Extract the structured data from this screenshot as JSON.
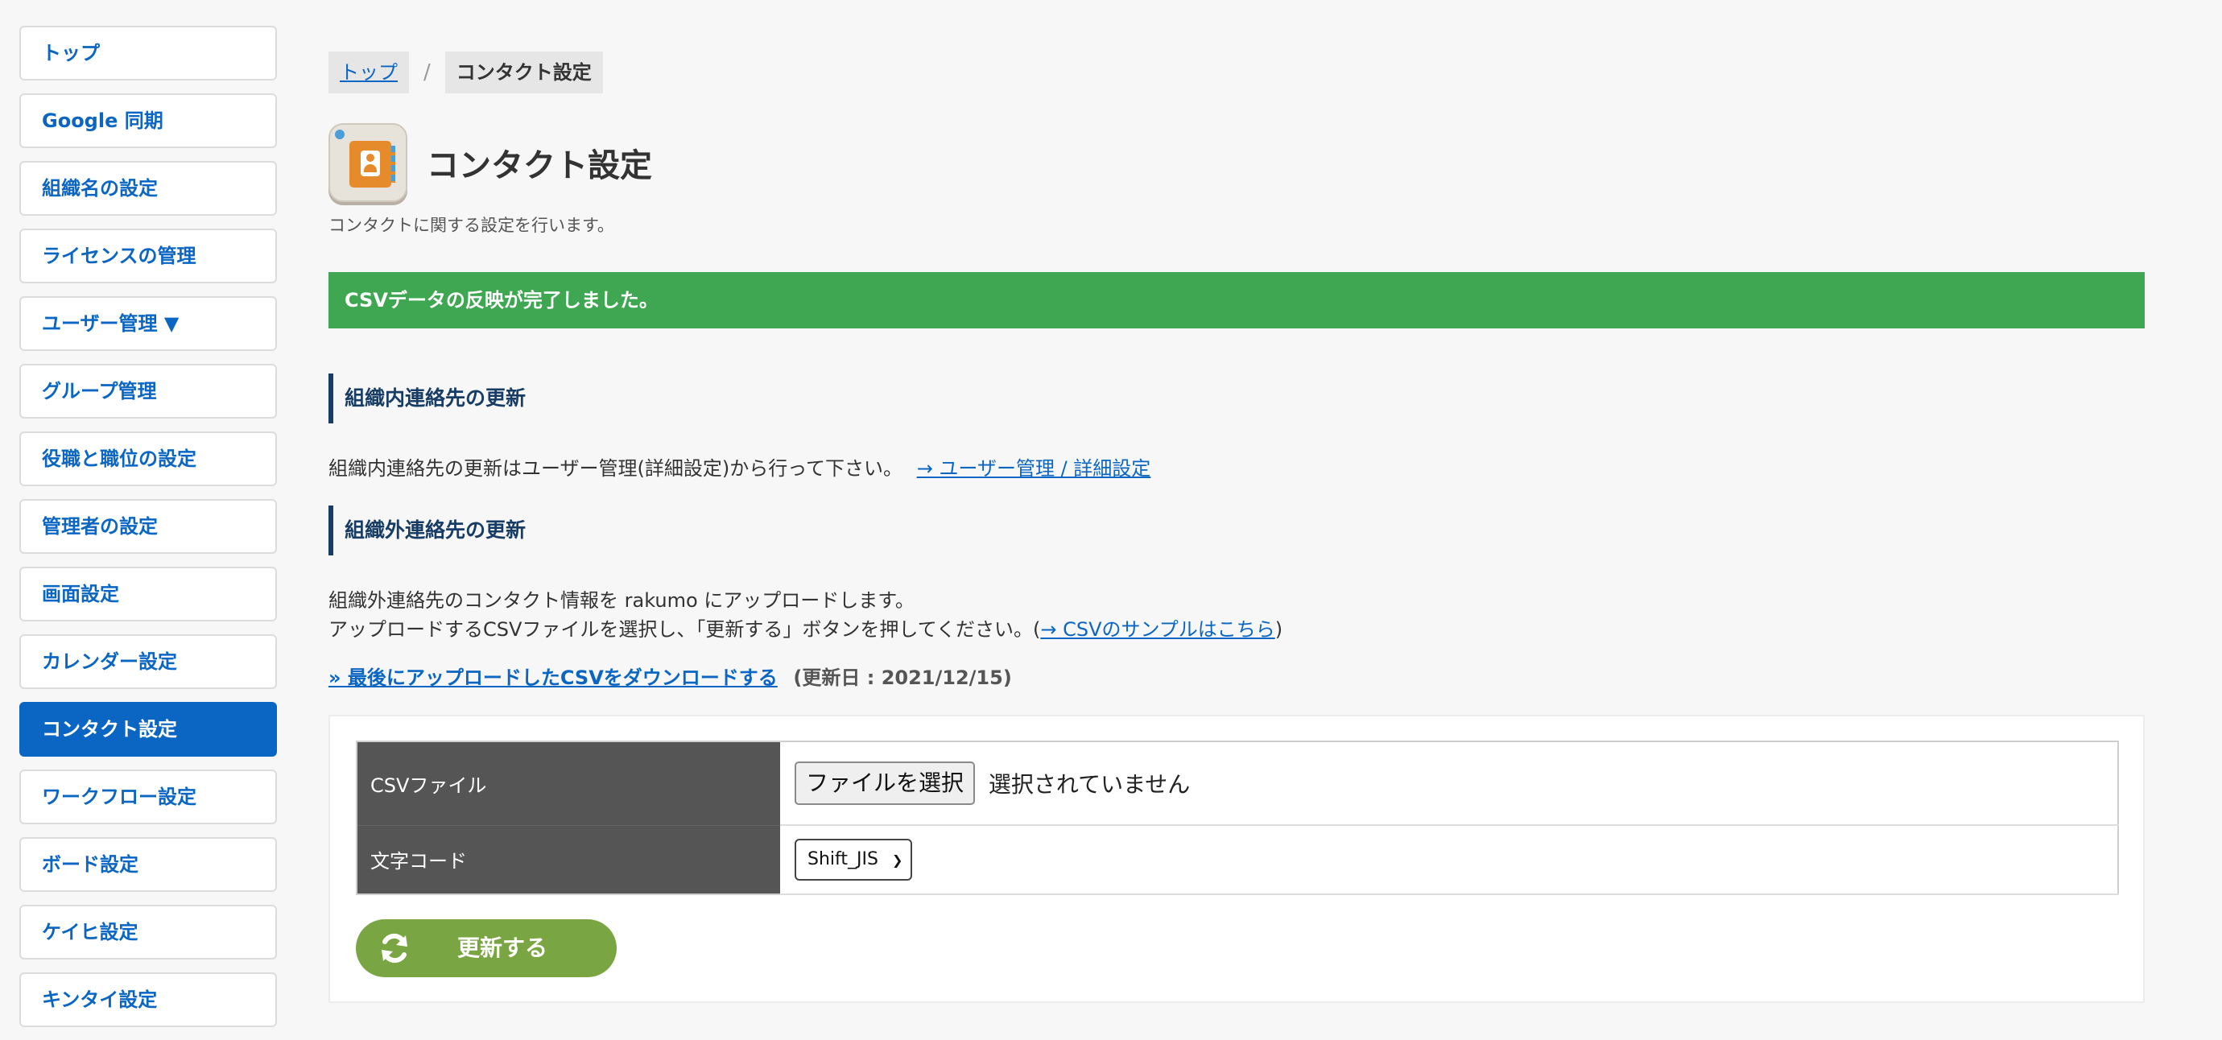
{
  "sidebar": {
    "items": [
      {
        "label": "トップ"
      },
      {
        "label": "Google 同期"
      },
      {
        "label": "組織名の設定"
      },
      {
        "label": "ライセンスの管理"
      },
      {
        "label": "ユーザー管理 ▼"
      },
      {
        "label": "グループ管理"
      },
      {
        "label": "役職と職位の設定"
      },
      {
        "label": "管理者の設定"
      },
      {
        "label": "画面設定"
      },
      {
        "label": "カレンダー設定"
      },
      {
        "label": "コンタクト設定",
        "active": true
      },
      {
        "label": "ワークフロー設定"
      },
      {
        "label": "ボード設定"
      },
      {
        "label": "ケイヒ設定"
      },
      {
        "label": "キンタイ設定"
      }
    ]
  },
  "breadcrumb": {
    "top": "トップ",
    "separator": "/",
    "current": "コンタクト設定"
  },
  "header": {
    "title": "コンタクト設定",
    "description": "コンタクトに関する設定を行います。"
  },
  "alert": {
    "message": "CSVデータの反映が完了しました。",
    "color": "#3fa652"
  },
  "internal": {
    "heading": "組織内連絡先の更新",
    "text": "組織内連絡先の更新はユーザー管理(詳細設定)から行って下さい。",
    "link": "→ ユーザー管理 / 詳細設定"
  },
  "external": {
    "heading": "組織外連絡先の更新",
    "line1": "組織外連絡先のコンタクト情報を rakumo にアップロードします。",
    "line2_prefix": "アップロードするCSVファイルを選択し、「更新する」ボタンを押してください。(",
    "sample_link": "→ CSVのサンプルはこちら",
    "line2_suffix": ")",
    "download_link": "» 最後にアップロードしたCSVをダウンロードする",
    "updated": "(更新日 : 2021/12/15)"
  },
  "form": {
    "csv_label": "CSVファイル",
    "file_button": "ファイルを選択",
    "file_status": "選択されていません",
    "encoding_label": "文字コード",
    "encoding_value": "Shift_JIS",
    "submit_label": "更新する"
  },
  "colors": {
    "accent": "#0a66c2",
    "heading": "#173c66",
    "submit": "#7aa543"
  }
}
